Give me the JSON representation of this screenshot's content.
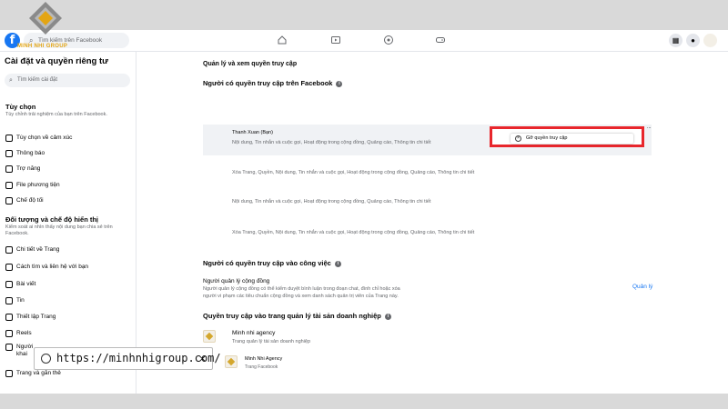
{
  "watermark": {
    "brand": "MINH NHI GROUP"
  },
  "topbar": {
    "search_placeholder": "Tìm kiếm trên Facebook",
    "logo_letter": "f",
    "icons": [
      "home-icon",
      "video-icon",
      "marketplace-icon",
      "gaming-icon"
    ],
    "right_icons": [
      "menu-grid-icon",
      "notifications-icon",
      "profile-icon"
    ]
  },
  "sidebar": {
    "title": "Cài đặt và quyền riêng tư",
    "search_placeholder": "Tìm kiếm cài đặt",
    "section1": {
      "heading": "Tùy chọn",
      "desc": "Tùy chỉnh trải nghiệm của bạn trên Facebook."
    },
    "items1": [
      "Tùy chọn về cảm xúc",
      "Thông báo",
      "Trợ năng",
      "File phương tiện",
      "Chế độ tối"
    ],
    "section2": {
      "heading": "Đối tượng và chế độ hiển thị",
      "desc": "Kiểm soát ai nhìn thấy nội dung bạn chia sẻ trên Facebook."
    },
    "items2": [
      "Chi tiết về Trang",
      "Cách tìm và liên hệ với bạn",
      "Bài viết",
      "Tin",
      "Thiết lập Trang",
      "Reels",
      "Người",
      "Trang và gắn thẻ"
    ],
    "item_partial": "khai"
  },
  "main": {
    "title": "Quản lý và xem quyền truy cập",
    "section_fb": {
      "heading": "Người có quyền truy cập trên Facebook"
    },
    "rows": [
      {
        "name": "Thanh Xuan (Bạn)",
        "perms": "Nội dung, Tin nhắn và cuộc gọi, Hoạt động trong cộng đồng, Quảng cáo, Thông tin chi tiết"
      },
      {
        "name": "",
        "perms": "Xóa Trang, Quyền, Nội dung, Tin nhắn và cuộc gọi, Hoạt động trong cộng đồng, Quảng cáo, Thông tin chi tiết"
      },
      {
        "name": "",
        "perms": "Nội dung, Tin nhắn và cuộc gọi, Hoạt động trong cộng đồng, Quảng cáo, Thông tin chi tiết"
      },
      {
        "name": "",
        "perms": "Xóa Trang, Quyền, Nội dung, Tin nhắn và cuộc gọi, Hoạt động trong cộng đồng, Quảng cáo, Thông tin chi tiết"
      }
    ],
    "popup": {
      "remove_label": "Gỡ quyền truy cập",
      "more": "..."
    },
    "section_task": {
      "heading": "Người có quyền truy cập vào công việc",
      "role_title": "Người quản lý cộng đồng",
      "role_desc_1": "Người quản lý cộng đồng có thể kiểm duyệt bình luận trong đoạn chat, đình chỉ hoặc xóa",
      "role_desc_2": "người vi phạm các tiêu chuẩn cộng đồng và xem danh sách quản trị viên của Trang này.",
      "manage_link": "Quản lý"
    },
    "section_biz": {
      "heading": "Quyền truy cập vào trang quản lý tài sản doanh nghiệp",
      "agency_name": "Minh nhi agency",
      "agency_desc": "Trang quản lý tài sản doanh nghiệp",
      "page_name": "Minh Nhi Agency",
      "page_type": "Trang Facebook"
    }
  },
  "urlbar": {
    "url": "https://minhnhigroup.com/",
    "close": "×"
  }
}
